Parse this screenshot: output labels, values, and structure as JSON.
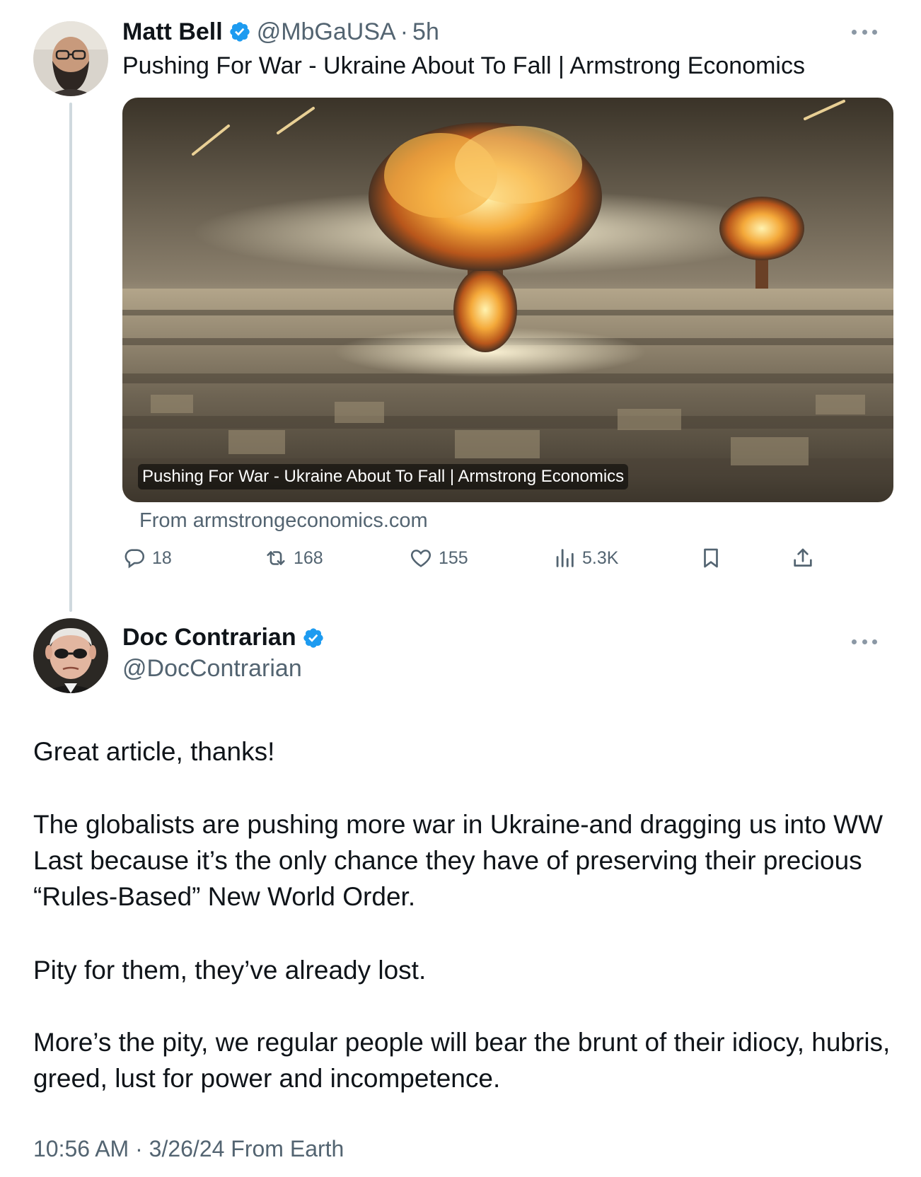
{
  "tweet1": {
    "author_name": "Matt Bell",
    "handle": "@MbGaUSA",
    "separator": "·",
    "time": "5h",
    "text": "Pushing For War - Ukraine About To Fall | Armstrong Economics",
    "card": {
      "caption": "Pushing For War - Ukraine About To Fall | Armstrong Economics",
      "source": "From armstrongeconomics.com"
    },
    "actions": {
      "replies": "18",
      "reposts": "168",
      "likes": "155",
      "views": "5.3K"
    }
  },
  "tweet2": {
    "author_name": "Doc Contrarian",
    "handle": "@DocContrarian",
    "paragraphs": [
      "Great article, thanks!",
      "The globalists are pushing more war in Ukraine-and dragging us into WW Last because it’s the only chance they have of preserving their precious “Rules-Based” New World Order.",
      "Pity for them, they’ve already lost.",
      "More’s the pity, we regular people will bear the brunt of their idiocy, hubris, greed, lust for power and incompetence."
    ],
    "footer": "10:56 AM · 3/26/24 From Earth"
  },
  "icons": {
    "verified": "verified-badge-icon",
    "more": "more-icon",
    "reply": "reply-icon",
    "repost": "repost-icon",
    "like": "heart-icon",
    "views": "views-icon",
    "bookmark": "bookmark-icon",
    "share": "share-icon"
  },
  "colors": {
    "verified": "#1d9bf0",
    "secondary_text": "#536471",
    "primary_text": "#0f1419",
    "thread_line": "#cfd9de"
  }
}
